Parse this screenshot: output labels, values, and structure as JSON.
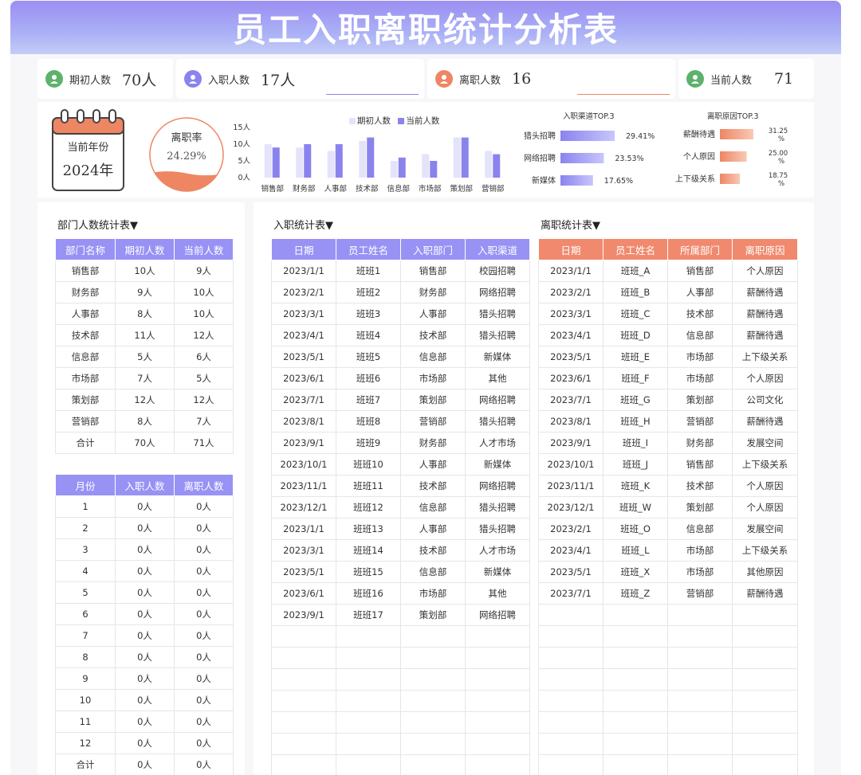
{
  "title": "员工入职离职统计分析表",
  "kpis": [
    {
      "label": "期初人数",
      "value": "70人"
    },
    {
      "label": "入职人数",
      "value": "17人"
    },
    {
      "label": "离职人数",
      "value": "16"
    },
    {
      "label": "当前人数",
      "value": "71"
    }
  ],
  "year": {
    "label": "当前年份",
    "value": "2024年"
  },
  "rate": {
    "label": "离职率",
    "value": "24.29%",
    "fill": 0.2429
  },
  "colors": {
    "purple": "#8a83ee",
    "purple_light": "#e4e3fa",
    "orange": "#ee8663",
    "header": "#9b8ef2"
  },
  "chart_data": [
    {
      "type": "bar",
      "categories": [
        "销售部",
        "财务部",
        "人事部",
        "技术部",
        "信息部",
        "市场部",
        "策划部",
        "营销部"
      ],
      "series": [
        {
          "name": "期初人数",
          "values": [
            10,
            9,
            8,
            11,
            5,
            7,
            12,
            8
          ]
        },
        {
          "name": "当前人数",
          "values": [
            9,
            10,
            10,
            12,
            6,
            5,
            12,
            7
          ]
        }
      ],
      "yticks": [
        "0人",
        "5人",
        "10人",
        "15人"
      ],
      "ylim": [
        0,
        15
      ],
      "legend": "top"
    },
    {
      "type": "bar",
      "title": "入职渠道TOP.3",
      "categories": [
        "猎头招聘",
        "网络招聘",
        "新媒体"
      ],
      "values": [
        29.41,
        23.53,
        17.65
      ],
      "labels": [
        "29.41%",
        "23.53%",
        "17.65%"
      ]
    },
    {
      "type": "bar",
      "title": "离职原因TOP.3",
      "categories": [
        "薪酬待遇",
        "个人原因",
        "上下级关系"
      ],
      "values": [
        31.25,
        25.0,
        18.75
      ],
      "labels": [
        "31.25",
        "25.00",
        "18.75"
      ],
      "unit": "%"
    }
  ],
  "dept_table": {
    "title": "部门人数统计表▼",
    "headers": [
      "部门名称",
      "期初人数",
      "当前人数"
    ],
    "rows": [
      [
        "销售部",
        "10人",
        "9人"
      ],
      [
        "财务部",
        "9人",
        "10人"
      ],
      [
        "人事部",
        "8人",
        "10人"
      ],
      [
        "技术部",
        "11人",
        "12人"
      ],
      [
        "信息部",
        "5人",
        "6人"
      ],
      [
        "市场部",
        "7人",
        "5人"
      ],
      [
        "策划部",
        "12人",
        "12人"
      ],
      [
        "营销部",
        "8人",
        "7人"
      ],
      [
        "合计",
        "70人",
        "71人"
      ]
    ]
  },
  "month_table": {
    "headers": [
      "月份",
      "入职人数",
      "离职人数"
    ],
    "rows": [
      [
        "1",
        "0人",
        "0人"
      ],
      [
        "2",
        "0人",
        "0人"
      ],
      [
        "3",
        "0人",
        "0人"
      ],
      [
        "4",
        "0人",
        "0人"
      ],
      [
        "5",
        "0人",
        "0人"
      ],
      [
        "6",
        "0人",
        "0人"
      ],
      [
        "7",
        "0人",
        "0人"
      ],
      [
        "8",
        "0人",
        "0人"
      ],
      [
        "9",
        "0人",
        "0人"
      ],
      [
        "10",
        "0人",
        "0人"
      ],
      [
        "11",
        "0人",
        "0人"
      ],
      [
        "12",
        "0人",
        "0人"
      ],
      [
        "合计",
        "0人",
        "0人"
      ]
    ]
  },
  "join_table": {
    "title": "入职统计表▼",
    "headers": [
      "日期",
      "员工姓名",
      "入职部门",
      "入职渠道"
    ],
    "rows": [
      [
        "2023/1/1",
        "班班1",
        "销售部",
        "校园招聘"
      ],
      [
        "2023/2/1",
        "班班2",
        "财务部",
        "网络招聘"
      ],
      [
        "2023/3/1",
        "班班3",
        "人事部",
        "猎头招聘"
      ],
      [
        "2023/4/1",
        "班班4",
        "技术部",
        "猎头招聘"
      ],
      [
        "2023/5/1",
        "班班5",
        "信息部",
        "新媒体"
      ],
      [
        "2023/6/1",
        "班班6",
        "市场部",
        "其他"
      ],
      [
        "2023/7/1",
        "班班7",
        "策划部",
        "网络招聘"
      ],
      [
        "2023/8/1",
        "班班8",
        "营销部",
        "猎头招聘"
      ],
      [
        "2023/9/1",
        "班班9",
        "财务部",
        "人才市场"
      ],
      [
        "2023/10/1",
        "班班10",
        "人事部",
        "新媒体"
      ],
      [
        "2023/11/1",
        "班班11",
        "技术部",
        "网络招聘"
      ],
      [
        "2023/12/1",
        "班班12",
        "信息部",
        "猎头招聘"
      ],
      [
        "2023/1/1",
        "班班13",
        "人事部",
        "猎头招聘"
      ],
      [
        "2023/3/1",
        "班班14",
        "技术部",
        "人才市场"
      ],
      [
        "2023/5/1",
        "班班15",
        "信息部",
        "新媒体"
      ],
      [
        "2023/6/1",
        "班班16",
        "市场部",
        "其他"
      ],
      [
        "2023/9/1",
        "班班17",
        "策划部",
        "网络招聘"
      ],
      [
        "",
        "",
        "",
        ""
      ],
      [
        "",
        "",
        "",
        ""
      ],
      [
        "",
        "",
        "",
        ""
      ],
      [
        "",
        "",
        "",
        ""
      ],
      [
        "",
        "",
        "",
        ""
      ],
      [
        "",
        "",
        "",
        ""
      ],
      [
        "",
        "",
        "",
        ""
      ]
    ]
  },
  "leave_table": {
    "title": "离职统计表▼",
    "headers": [
      "日期",
      "员工姓名",
      "所属部门",
      "离职原因"
    ],
    "rows": [
      [
        "2023/1/1",
        "班班_A",
        "销售部",
        "个人原因"
      ],
      [
        "2023/2/1",
        "班班_B",
        "人事部",
        "薪酬待遇"
      ],
      [
        "2023/3/1",
        "班班_C",
        "技术部",
        "薪酬待遇"
      ],
      [
        "2023/4/1",
        "班班_D",
        "信息部",
        "薪酬待遇"
      ],
      [
        "2023/5/1",
        "班班_E",
        "市场部",
        "上下级关系"
      ],
      [
        "2023/6/1",
        "班班_F",
        "市场部",
        "个人原因"
      ],
      [
        "2023/7/1",
        "班班_G",
        "策划部",
        "公司文化"
      ],
      [
        "2023/8/1",
        "班班_H",
        "营销部",
        "薪酬待遇"
      ],
      [
        "2023/9/1",
        "班班_I",
        "财务部",
        "发展空间"
      ],
      [
        "2023/10/1",
        "班班_J",
        "销售部",
        "上下级关系"
      ],
      [
        "2023/11/1",
        "班班_K",
        "技术部",
        "个人原因"
      ],
      [
        "2023/12/1",
        "班班_W",
        "策划部",
        "个人原因"
      ],
      [
        "2023/2/1",
        "班班_O",
        "信息部",
        "发展空间"
      ],
      [
        "2023/4/1",
        "班班_L",
        "市场部",
        "上下级关系"
      ],
      [
        "2023/5/1",
        "班班_X",
        "市场部",
        "其他原因"
      ],
      [
        "2023/7/1",
        "班班_Z",
        "营销部",
        "薪酬待遇"
      ],
      [
        "",
        "",
        "",
        ""
      ],
      [
        "",
        "",
        "",
        ""
      ],
      [
        "",
        "",
        "",
        ""
      ],
      [
        "",
        "",
        "",
        ""
      ],
      [
        "",
        "",
        "",
        ""
      ],
      [
        "",
        "",
        "",
        ""
      ],
      [
        "",
        "",
        "",
        ""
      ],
      [
        "",
        "",
        "",
        ""
      ]
    ]
  }
}
